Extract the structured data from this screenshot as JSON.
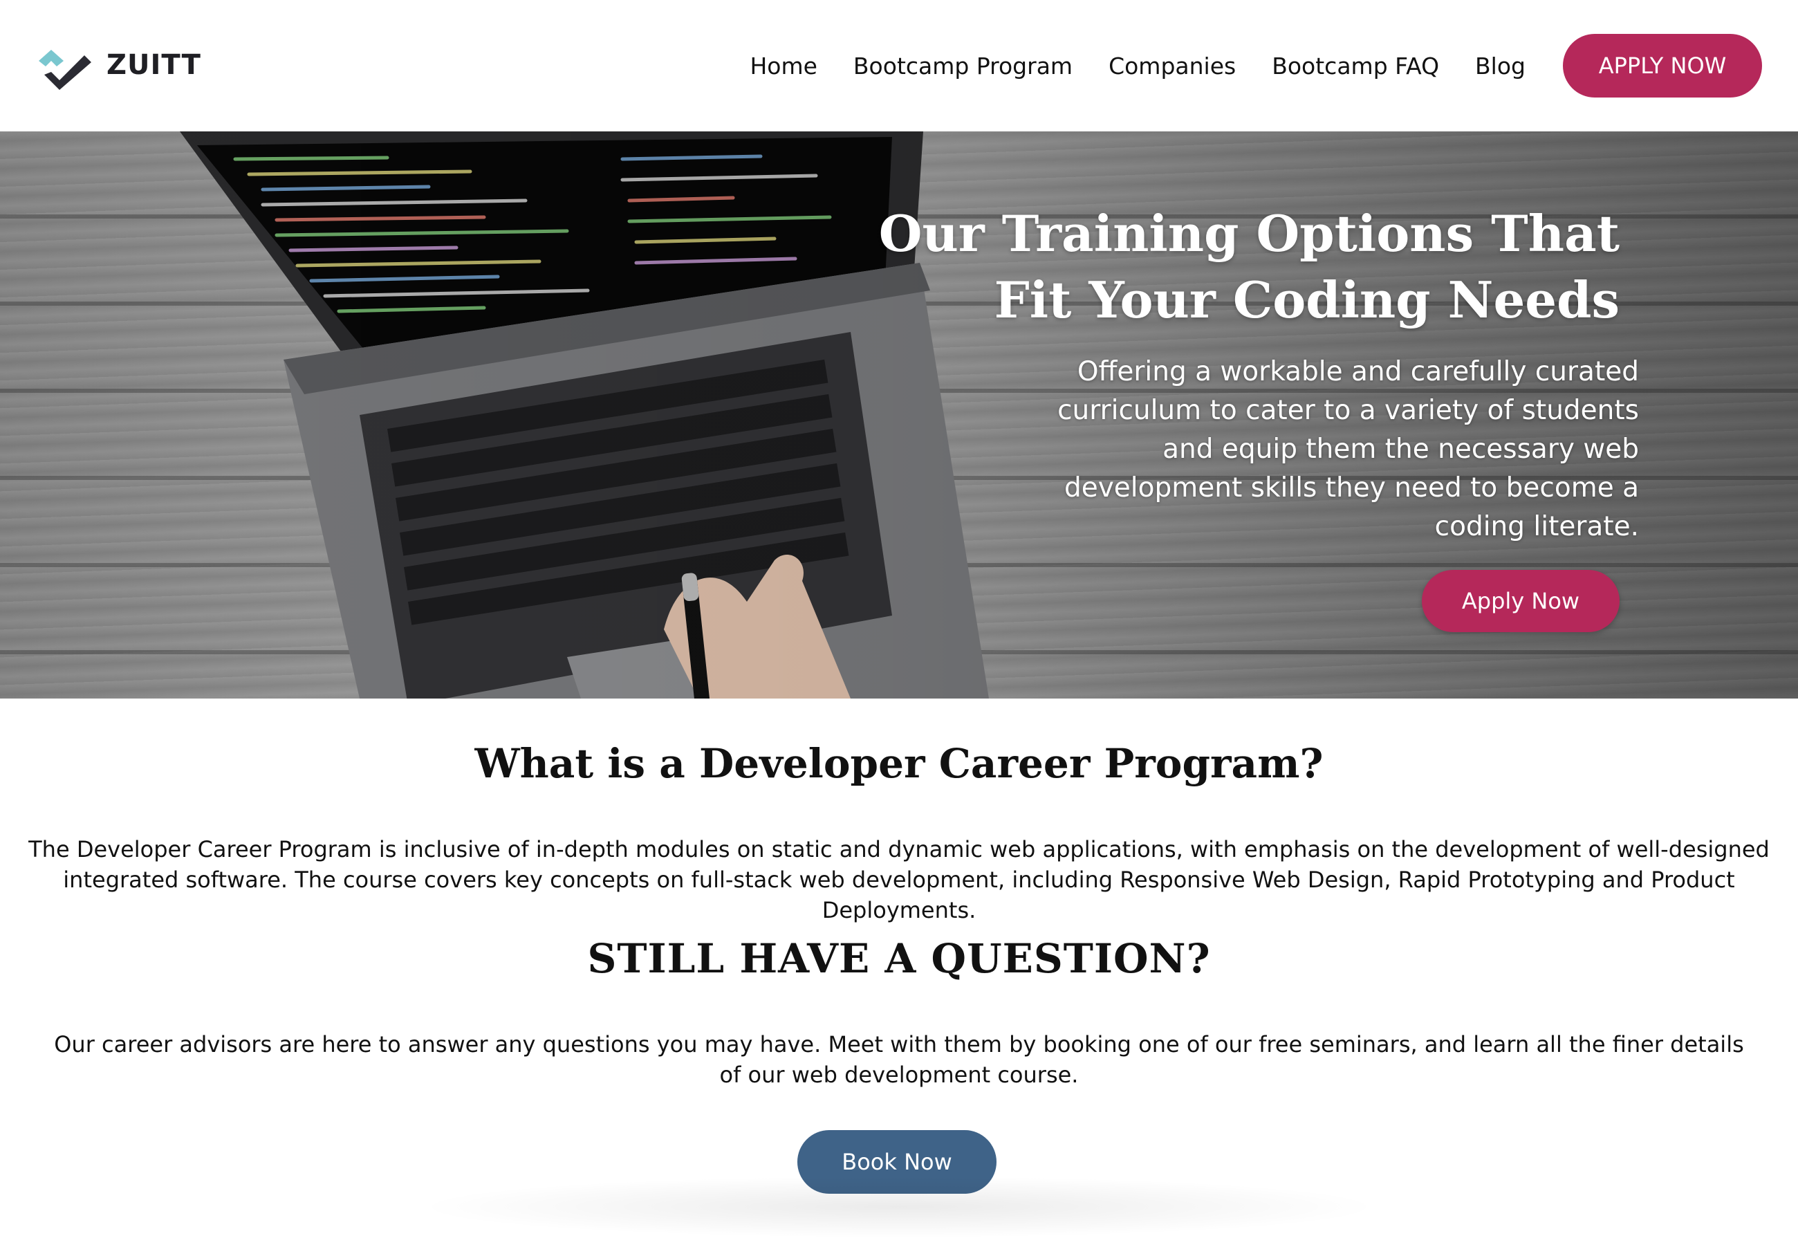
{
  "header": {
    "logo_text": "ZUITT",
    "nav": [
      "Home",
      "Bootcamp Program",
      "Companies",
      "Bootcamp FAQ",
      "Blog"
    ],
    "apply_label": "APPLY NOW"
  },
  "hero": {
    "title_line1": "Our Training Options That",
    "title_line2": "Fit Your Coding Needs",
    "subtitle": "Offering a workable and carefully curated curriculum to cater to a variety of students and equip them the necessary web development skills they need to become a coding literate.",
    "apply_label": "Apply Now",
    "image": "laptop-keyboard-photo"
  },
  "program": {
    "title": "What is a Developer Career Program?",
    "description": "The Developer Career Program is inclusive of in-depth modules on static and dynamic web applications, with emphasis on the development of well-designed integrated software. The course covers key concepts on full-stack web development, including Responsive Web Design, Rapid Prototyping and Product Deployments."
  },
  "question": {
    "title": "STILL HAVE A QUESTION?",
    "description": "Our career advisors are here to answer any questions you may have. Meet with them by booking one of our free seminars, and learn all the finer details of our web development course.",
    "book_label": "Book Now"
  },
  "colors": {
    "accent": "#b5285a",
    "secondary": "#3f6388",
    "logo_teal": "#7ac7cf",
    "logo_dark": "#2b2b33"
  }
}
